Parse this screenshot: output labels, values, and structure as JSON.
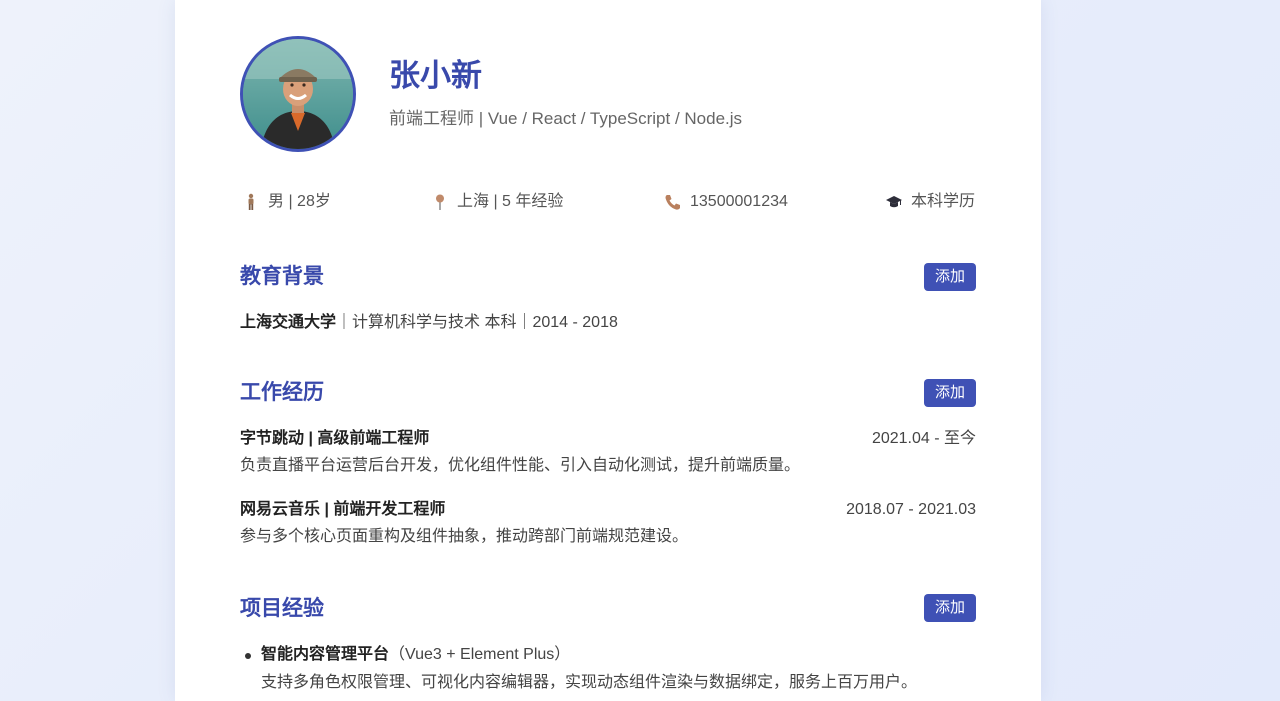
{
  "profile": {
    "name": "张小新",
    "subtitle": "前端工程师 | Vue / React / TypeScript / Node.js",
    "avatar": "avatar-photo"
  },
  "info": {
    "gender_age": "男 | 28岁",
    "location_exp": "上海 | 5 年经验",
    "phone": "13500001234",
    "degree": "本科学历",
    "icons": [
      "person-icon",
      "pin-icon",
      "phone-icon",
      "graduation-cap-icon"
    ]
  },
  "education": {
    "title": "教育背景",
    "add_label": "添加",
    "school": "上海交通大学",
    "details": "｜计算机科学与技术 本科｜2014 - 2018"
  },
  "work": {
    "title": "工作经历",
    "add_label": "添加",
    "items": [
      {
        "title": "字节跳动 | 高级前端工程师",
        "date": "2021.04 - 至今",
        "desc": "负责直播平台运营后台开发，优化组件性能、引入自动化测试，提升前端质量。"
      },
      {
        "title": "网易云音乐 | 前端开发工程师",
        "date": "2018.07 - 2021.03",
        "desc": "参与多个核心页面重构及组件抽象，推动跨部门前端规范建设。"
      }
    ]
  },
  "projects": {
    "title": "项目经验",
    "add_label": "添加",
    "items": [
      {
        "name": "智能内容管理平台",
        "stack": "（Vue3 + Element Plus）",
        "desc": "支持多角色权限管理、可视化内容编辑器，实现动态组件渲染与数据绑定，服务上百万用户。"
      }
    ]
  },
  "colors": {
    "accent": "#3f51b5",
    "heading": "#3949ab"
  }
}
